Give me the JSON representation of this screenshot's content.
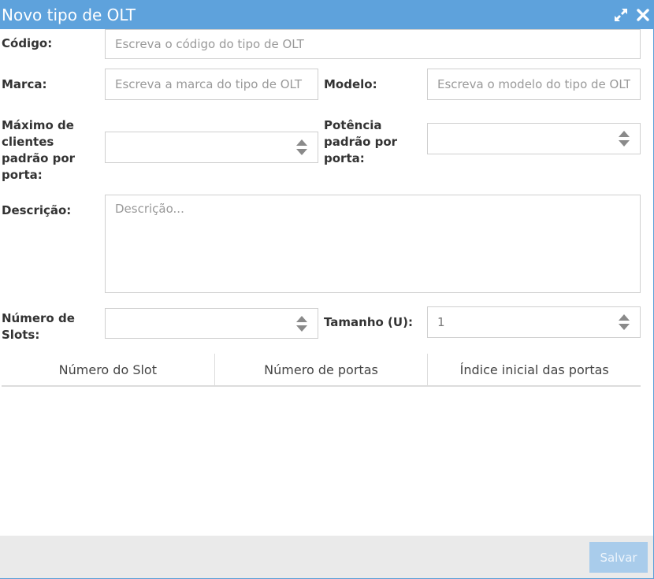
{
  "window": {
    "title": "Novo tipo de OLT"
  },
  "form": {
    "codigo": {
      "label": "Código:",
      "placeholder": "Escreva o código do tipo de OLT",
      "value": ""
    },
    "marca": {
      "label": "Marca:",
      "placeholder": "Escreva a marca do tipo de OLT",
      "value": ""
    },
    "modelo": {
      "label": "Modelo:",
      "placeholder": "Escreva o modelo do tipo de OLT",
      "value": ""
    },
    "max_clientes": {
      "label_lines": [
        "Máximo de",
        "clientes",
        "padrão por",
        "porta:"
      ],
      "value": ""
    },
    "potencia": {
      "label_lines": [
        "Potência",
        "padrão por",
        "porta:"
      ],
      "value": ""
    },
    "descricao": {
      "label": "Descrição:",
      "placeholder": "Descrição...",
      "value": ""
    },
    "num_slots": {
      "label_lines": [
        "Número de",
        "Slots:"
      ],
      "value": ""
    },
    "tamanho": {
      "label": "Tamanho (U):",
      "value": "1"
    }
  },
  "slots_table": {
    "columns": [
      "Número do Slot",
      "Número de portas",
      "Índice inicial das portas"
    ],
    "rows": []
  },
  "footer": {
    "save_label": "Salvar"
  },
  "colors": {
    "titlebar": "#5ea2dc",
    "save_button": "#a9cceb",
    "footer": "#eaeaea"
  },
  "icons": {
    "expand": "expand-arrows-icon",
    "close": "close-x-icon",
    "spinner": "spinner-arrows-icon"
  }
}
